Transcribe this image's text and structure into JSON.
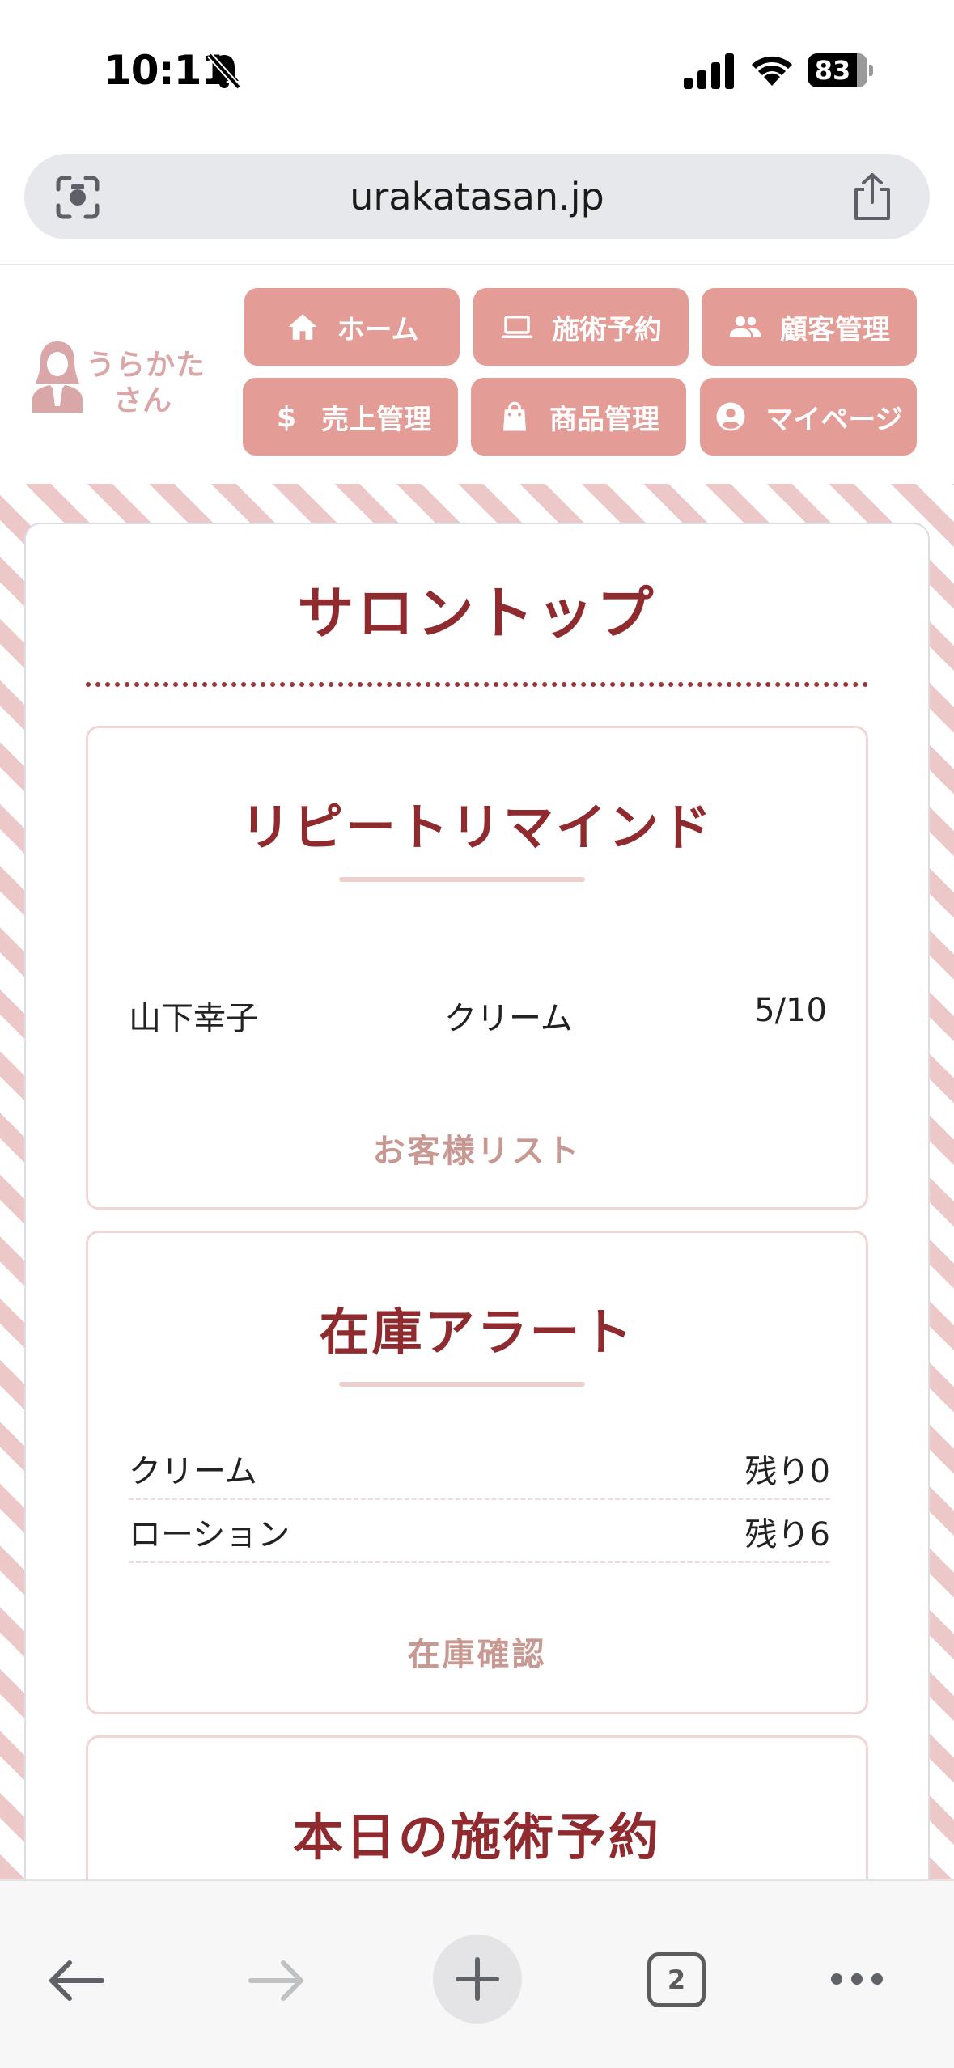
{
  "status_bar": {
    "time": "10:11",
    "battery": "83",
    "battery_level": 0.83
  },
  "browser": {
    "url": "urakatasan.jp",
    "tab_count": "2"
  },
  "site": {
    "logo_line1": "うらかた",
    "logo_line2": "さん",
    "nav": [
      {
        "label": "ホーム",
        "icon": "home-icon"
      },
      {
        "label": "施術予約",
        "icon": "laptop-icon"
      },
      {
        "label": "顧客管理",
        "icon": "people-icon"
      },
      {
        "label": "売上管理",
        "icon": "dollar-icon"
      },
      {
        "label": "商品管理",
        "icon": "shopping-bag-icon"
      },
      {
        "label": "マイページ",
        "icon": "account-circle-icon"
      }
    ]
  },
  "page": {
    "title": "サロントップ"
  },
  "repeat_remind": {
    "title": "リピートリマインド",
    "row": {
      "customer": "山下幸子",
      "product": "クリーム",
      "date": "5/10"
    },
    "link": "お客様リスト"
  },
  "stock_alert": {
    "title": "在庫アラート",
    "items": [
      {
        "name": "クリーム",
        "remaining": "残り0"
      },
      {
        "name": "ローション",
        "remaining": "残り6"
      }
    ],
    "link": "在庫確認"
  },
  "today_bookings": {
    "title": "本日の施術予約"
  },
  "colors": {
    "accent": "#e49c96",
    "title": "#8f2a2e",
    "link": "#c89992",
    "stripe": "#ecc8c8"
  }
}
